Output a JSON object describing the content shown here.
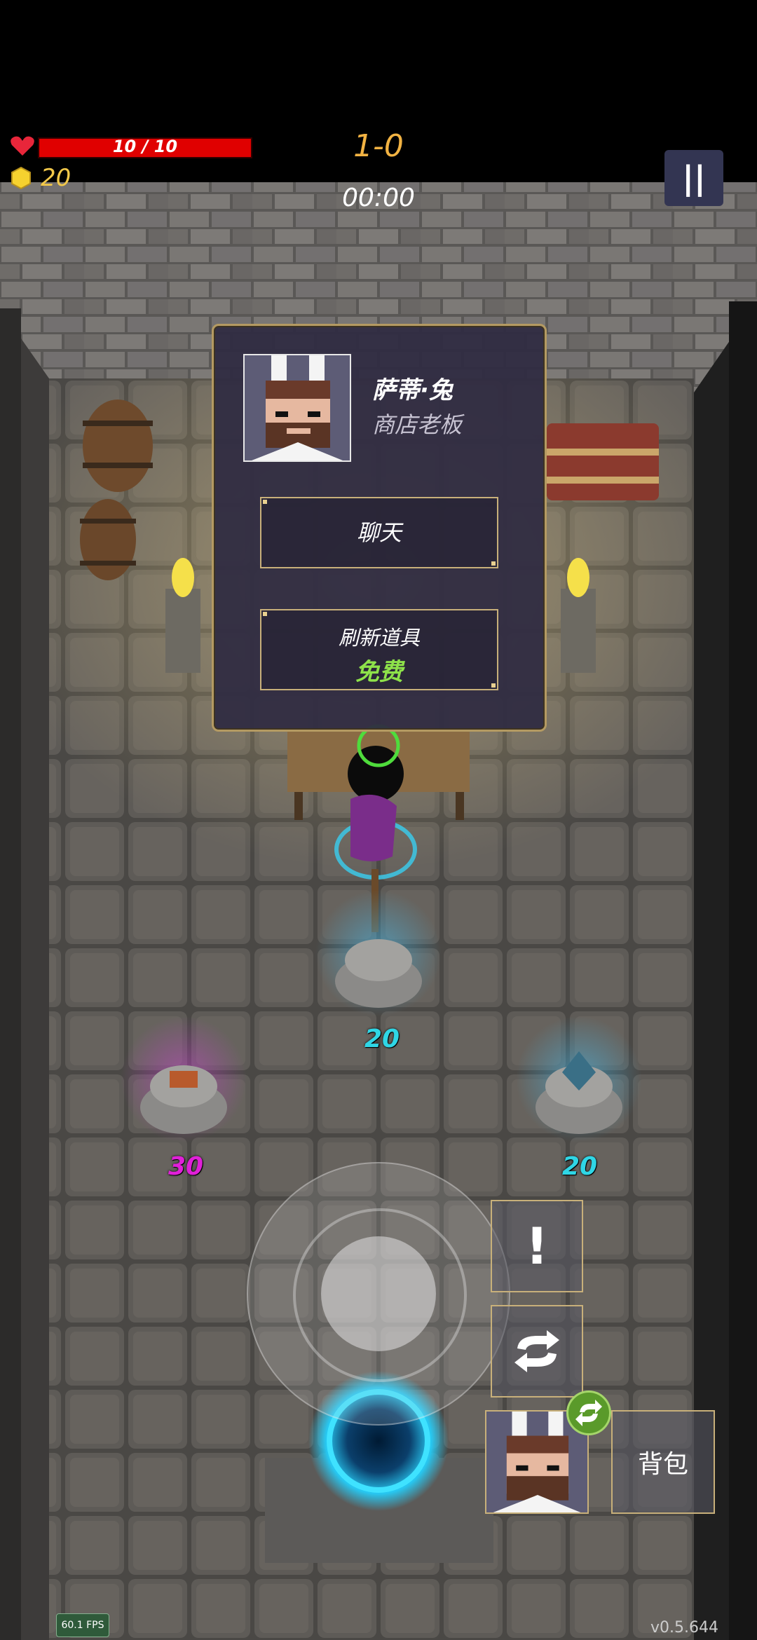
{
  "hud": {
    "hp_text": "10 / 10",
    "hp_fraction": 1.0,
    "gold": "20",
    "level": "1-0",
    "timer": "00:00",
    "pause_icon": "pause-icon"
  },
  "dialog": {
    "npc_name": "萨蒂·兔",
    "npc_role": "商店老板",
    "chat_label": "聊天",
    "refresh_label": "刷新道具",
    "refresh_price": "免费"
  },
  "shop_items": [
    {
      "price": "20",
      "color": "#2fd6e6"
    },
    {
      "price": "30",
      "color": "#e020d8"
    },
    {
      "price": "20",
      "color": "#2fd6e6"
    }
  ],
  "controls": {
    "alert_label": "!",
    "swap_icon": "swap-icon",
    "backpack_label": "背包"
  },
  "footer": {
    "fps": "60.1 FPS",
    "version": "v0.5.644"
  },
  "colors": {
    "hp": "#e00000",
    "level": "#f2b343",
    "gold": "#f2c84a",
    "free": "#8ee24a",
    "frame": "#c8b07a"
  }
}
